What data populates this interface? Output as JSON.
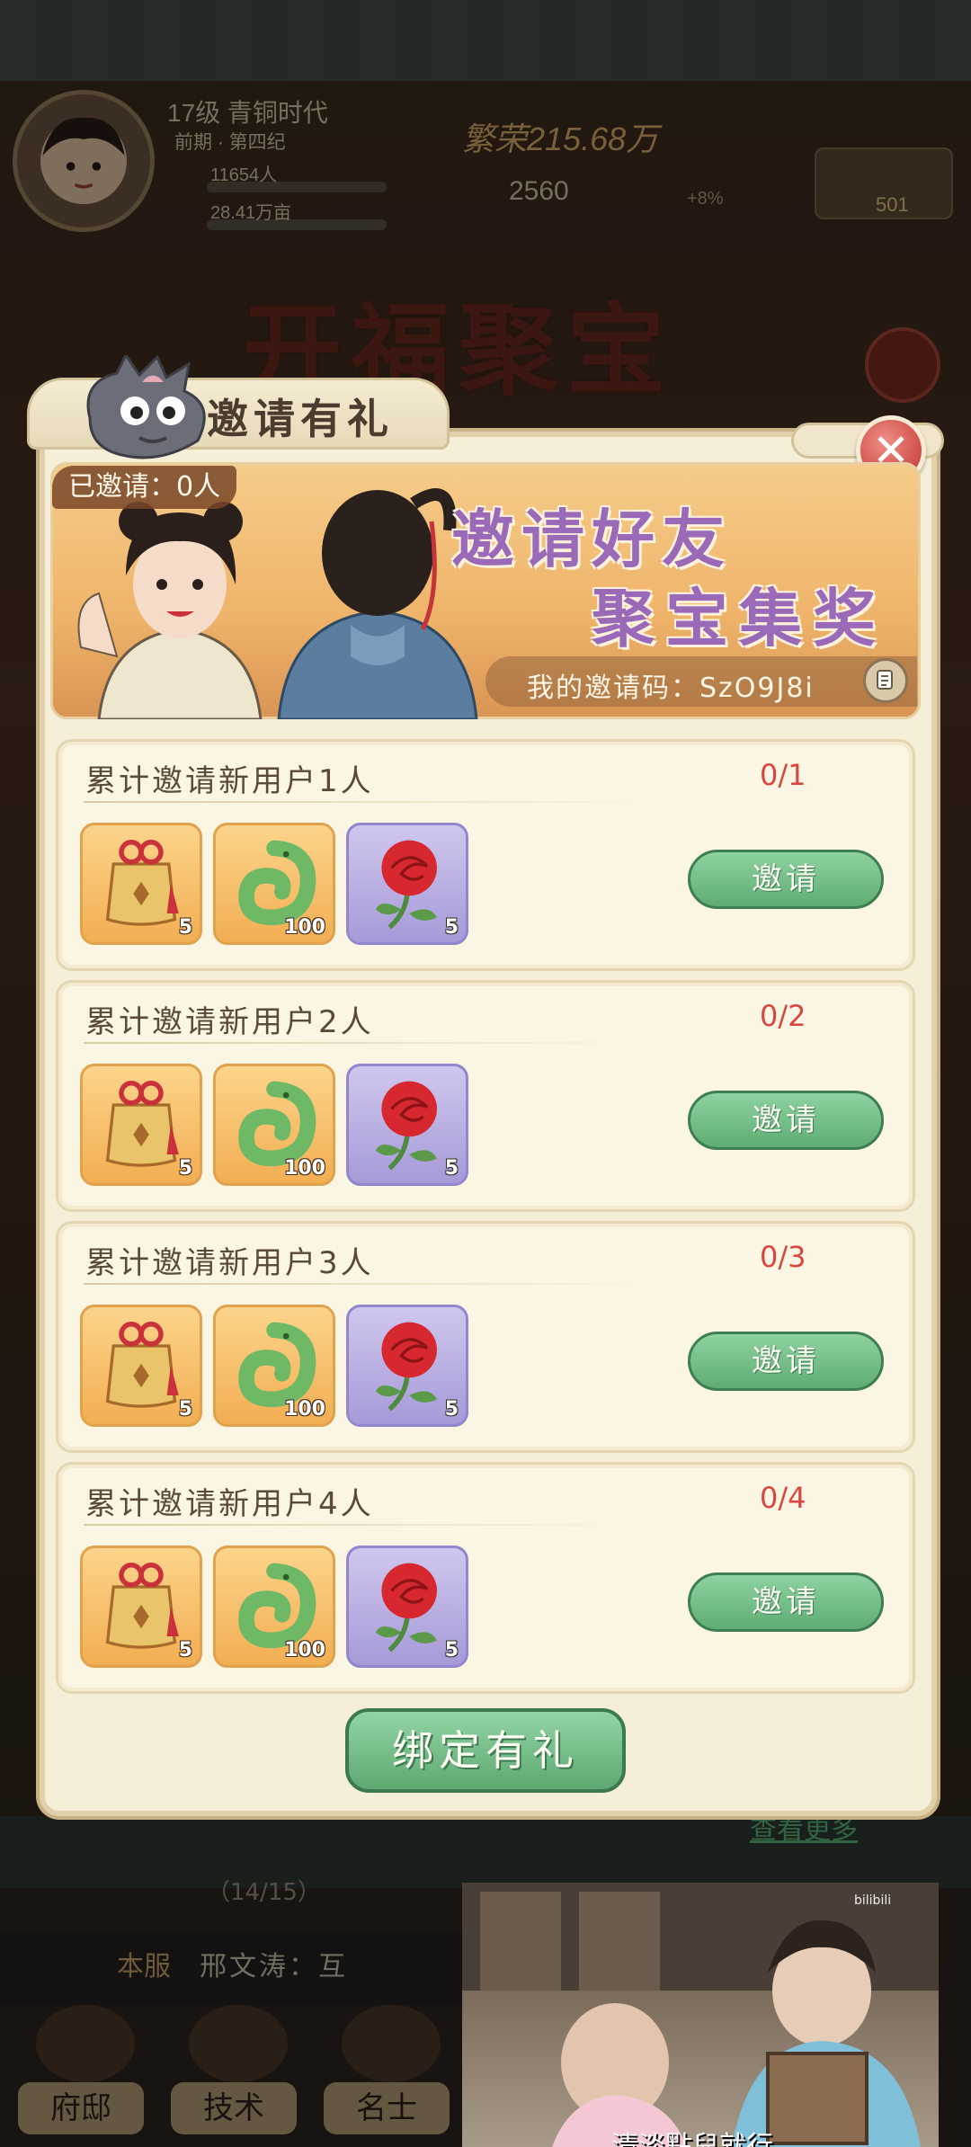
{
  "hud": {
    "level": "17级 青铜时代",
    "era": "前期 · 第四纪",
    "population": "11654人",
    "land": "28.41万亩",
    "prosperity": "繁荣215.68万",
    "count": "2560",
    "percent": "+8%",
    "gold": "501"
  },
  "background_title": "开福聚宝",
  "modal": {
    "title": "邀请有礼",
    "invited_count": "已邀请：0人",
    "banner_line1": "邀请好友",
    "banner_line2": "聚宝集奖",
    "invite_code": "我的邀请码：SzO9J8i"
  },
  "tasks": [
    {
      "title": "累计邀请新用户1人",
      "progress": "0/1",
      "button": "邀请",
      "rewards": [
        {
          "icon": "pouch-icon",
          "qty": "5"
        },
        {
          "icon": "jade-dragon-icon",
          "qty": "100"
        },
        {
          "icon": "rose-icon",
          "qty": "5"
        }
      ]
    },
    {
      "title": "累计邀请新用户2人",
      "progress": "0/2",
      "button": "邀请",
      "rewards": [
        {
          "icon": "pouch-icon",
          "qty": "5"
        },
        {
          "icon": "jade-dragon-icon",
          "qty": "100"
        },
        {
          "icon": "rose-icon",
          "qty": "5"
        }
      ]
    },
    {
      "title": "累计邀请新用户3人",
      "progress": "0/3",
      "button": "邀请",
      "rewards": [
        {
          "icon": "pouch-icon",
          "qty": "5"
        },
        {
          "icon": "jade-dragon-icon",
          "qty": "100"
        },
        {
          "icon": "rose-icon",
          "qty": "5"
        }
      ]
    },
    {
      "title": "累计邀请新用户4人",
      "progress": "0/4",
      "button": "邀请",
      "rewards": [
        {
          "icon": "pouch-icon",
          "qty": "5"
        },
        {
          "icon": "jade-dragon-icon",
          "qty": "100"
        },
        {
          "icon": "rose-icon",
          "qty": "5"
        }
      ]
    }
  ],
  "bind_button": "绑定有礼",
  "bottom": {
    "view_more": "查看更多",
    "progress": "（14/15）",
    "chat_tag": "本服",
    "chat_text": "邢文涛：互",
    "nav": [
      "府邸",
      "技术",
      "名士"
    ]
  },
  "video": {
    "subtitle": "清淡點兒就行",
    "watermark": "bilibili"
  },
  "colors": {
    "accent_green": "#5fad74",
    "progress_red": "#d8473f",
    "banner_purple": "#9a6ab8"
  }
}
